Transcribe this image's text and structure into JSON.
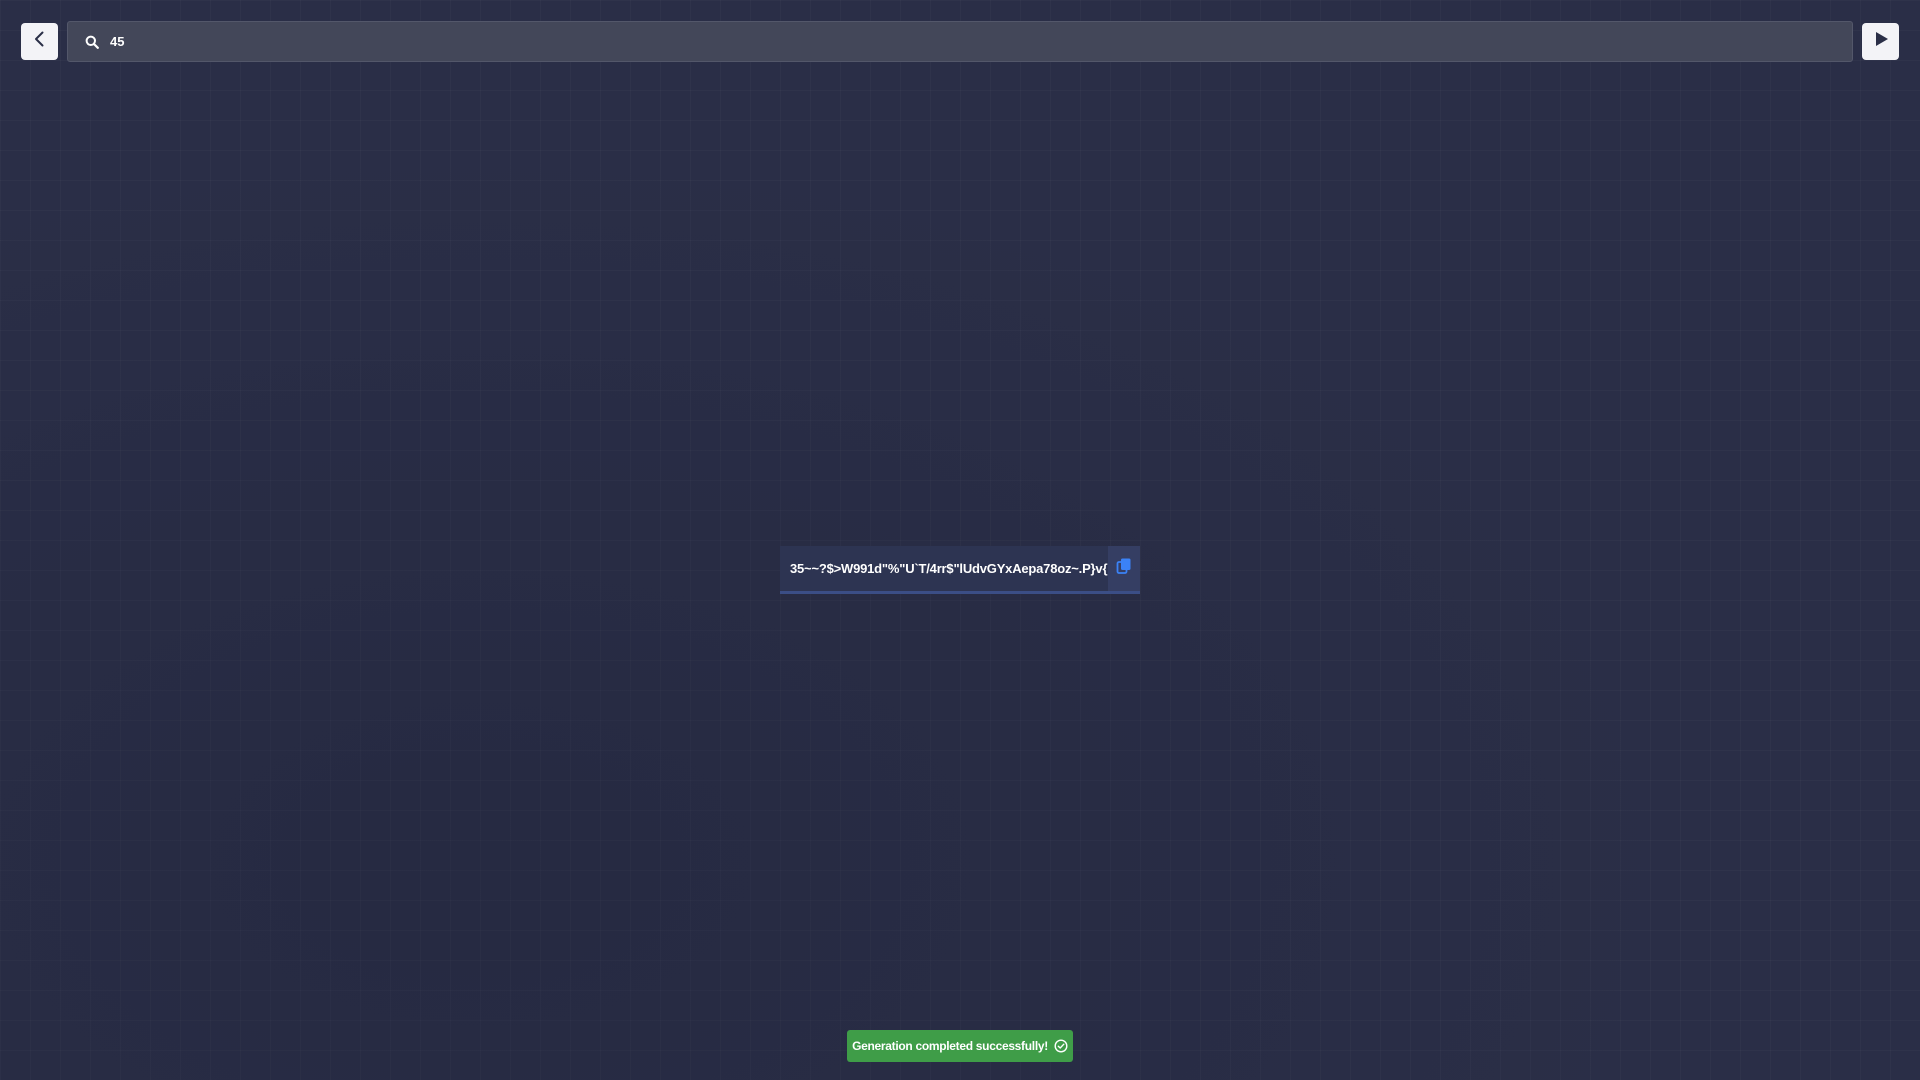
{
  "header": {
    "back_icon": "chevron-left-icon",
    "search": {
      "icon": "search-icon",
      "value": "45"
    },
    "play_icon": "play-icon"
  },
  "output": {
    "text": "35~~?$>W991d\"%\"U`T/4rr$\"lUdvGYxAepa78oz~.P}v{",
    "copy_icon": "copy-icon"
  },
  "toast": {
    "message": "Generation completed successfully!",
    "icon": "check-circle-icon"
  },
  "colors": {
    "background": "#2a2e47",
    "accent": "#3b82f6",
    "success": "#3f9d48"
  }
}
